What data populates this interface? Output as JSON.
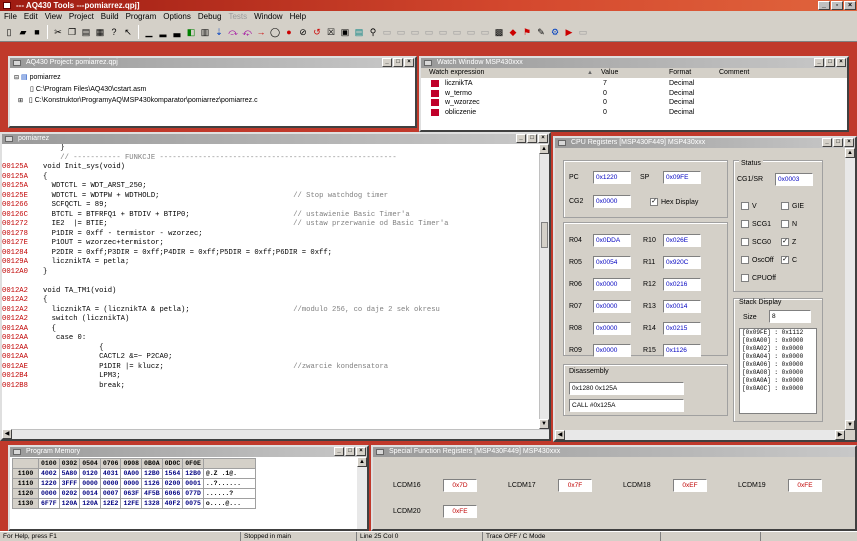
{
  "app": {
    "title": "--- AQ430 Tools ---pomiarrez.qpj]"
  },
  "menu": [
    "File",
    "Edit",
    "View",
    "Project",
    "Build",
    "Program",
    "Options",
    "Debug",
    "Tests",
    "Window",
    "Help"
  ],
  "menu_disabled": "Tests",
  "project": {
    "title": "AQ430 Project: pomiarrez.qpj",
    "root": "pomiarrez",
    "files": [
      "C:\\Program Files\\AQ430\\cstart.asm",
      "C:\\Konstruktor\\ProgramyAQ\\MSP430komparator\\pomiarrez\\pomiarrez.c"
    ]
  },
  "watch": {
    "title": "Watch Window MSP430xxx",
    "columns": [
      "Watch expression",
      "Value",
      "Format",
      "Comment"
    ],
    "rows": [
      {
        "expr": "licznikTA",
        "value": "7",
        "format": "Decimal"
      },
      {
        "expr": "w_termo",
        "value": "0",
        "format": "Decimal"
      },
      {
        "expr": "w_wzorzec",
        "value": "0",
        "format": "Decimal"
      },
      {
        "expr": "obliczenie",
        "value": "0",
        "format": "Decimal"
      }
    ]
  },
  "editor": {
    "title": "pomiarrez",
    "lines": [
      {
        "a": "",
        "c": "    }"
      },
      {
        "a": "",
        "c": "    // ----------- FUNKCJE -------------------------------------------------------",
        "cm": true
      },
      {
        "a": "00125A",
        "c": "void Init_sys(void)"
      },
      {
        "a": "00125A",
        "c": "{"
      },
      {
        "a": "00125A",
        "c": "  WDTCTL = WDT_ARST_250;"
      },
      {
        "a": "00125E",
        "c": "  WDTCTL = WDTPW + WDTHOLD;",
        "t": "// Stop watchdog timer"
      },
      {
        "a": "001266",
        "c": "  SCFQCTL = 89;"
      },
      {
        "a": "00126C",
        "c": "  BTCTL = BTFRFQ1 + BTDIV + BTIP0;",
        "t": "// ustawienie Basic Timer'a"
      },
      {
        "a": "001272",
        "c": "  IE2  |= BTIE;",
        "t": "// ustaw przerwanie od Basic Timer'a"
      },
      {
        "a": "001278",
        "c": "  P1DIR = 0xff - termistor - wzorzec;"
      },
      {
        "a": "00127E",
        "c": "  P1OUT = wzorzec+termistor;"
      },
      {
        "a": "001284",
        "c": "  P2DIR = 0xff;P3DIR = 0xff;P4DIR = 0xff;P5DIR = 0xff;P6DIR = 0xff;"
      },
      {
        "a": "00129A",
        "c": "  licznikTA = petla;"
      },
      {
        "a": "0012A0",
        "c": "}"
      },
      {
        "a": "",
        "c": ""
      },
      {
        "a": "0012A2",
        "c": "void TA_TM1(void)"
      },
      {
        "a": "0012A2",
        "c": "{"
      },
      {
        "a": "0012A2",
        "c": "  licznikTA = (licznikTA & petla);",
        "t": "//modulo 256, co daje 2 sek okresu"
      },
      {
        "a": "0012A2",
        "c": "  switch (licznikTA)"
      },
      {
        "a": "0012AA",
        "c": "  {"
      },
      {
        "a": "0012AA",
        "c": "   case 0:"
      },
      {
        "a": "0012AA",
        "c": "             {"
      },
      {
        "a": "0012AA",
        "c": "             CACTL2 &=~ P2CA0;"
      },
      {
        "a": "0012AE",
        "c": "             P1DIR |= klucz;",
        "t": "//zwarcie kondensatora"
      },
      {
        "a": "0012B4",
        "c": "             LPM3;"
      },
      {
        "a": "0012B8",
        "c": "             break;"
      }
    ]
  },
  "cpu": {
    "title": "CPU Registers [MSP430F449] MSP430xxx",
    "pc": {
      "label": "PC",
      "value": "0x1220"
    },
    "sp": {
      "label": "SP",
      "value": "0x09FE"
    },
    "cg2": {
      "label": "CG2",
      "value": "0x0000"
    },
    "hex_display": "Hex Display",
    "regs_left": [
      [
        "R04",
        "0x0DDA"
      ],
      [
        "R05",
        "0x0054"
      ],
      [
        "R06",
        "0x0000"
      ],
      [
        "R07",
        "0x0000"
      ],
      [
        "R08",
        "0x0000"
      ],
      [
        "R09",
        "0x0000"
      ]
    ],
    "regs_right": [
      [
        "R10",
        "0x026E"
      ],
      [
        "R11",
        "0x920C"
      ],
      [
        "R12",
        "0x0216"
      ],
      [
        "R13",
        "0x0014"
      ],
      [
        "R14",
        "0x0215"
      ],
      [
        "R15",
        "0x1126"
      ]
    ],
    "status": {
      "label": "Status",
      "cg1_label": "CG1/SR",
      "cg1_value": "0x0003",
      "flags": [
        [
          "V",
          false
        ],
        [
          "GIE",
          false
        ],
        [
          "SCG1",
          false
        ],
        [
          "N",
          false
        ],
        [
          "SCG0",
          false
        ],
        [
          "Z",
          true
        ],
        [
          "OscOff",
          false
        ],
        [
          "C",
          true
        ],
        [
          "CPUOff",
          false
        ]
      ]
    },
    "stack": {
      "label": "Stack Display",
      "size_label": "Size",
      "size": "8",
      "entries": [
        "[0x09FE] : 0x1112",
        "[0x0A00] : 0x0000",
        "[0x0A02] : 0x0000",
        "[0x0A04] : 0x0000",
        "[0x0A06] : 0x0000",
        "[0x0A08] : 0x0000",
        "[0x0A0A] : 0x0000",
        "[0x0A0C] : 0x0000"
      ]
    },
    "disasm": {
      "label": "Disassembly",
      "lines": [
        "0x1280 0x125A",
        "CALL #0x125A"
      ]
    }
  },
  "memory": {
    "title": "Program Memory",
    "header": [
      "",
      "0100",
      "0302",
      "0504",
      "0706",
      "0908",
      "0B0A",
      "0D0C",
      "0F0E",
      ""
    ],
    "rows": [
      [
        "1100",
        "4002",
        "5A80",
        "0120",
        "4031",
        "0A00",
        "12B0",
        "1564",
        "12B0",
        "@.Z .1@."
      ],
      [
        "1110",
        "1220",
        "3FFF",
        "0000",
        "0000",
        "0000",
        "1126",
        "0200",
        "0001",
        "..?......"
      ],
      [
        "1120",
        "0000",
        "0202",
        "0014",
        "0007",
        "063F",
        "4F5B",
        "6066",
        "077D",
        "......?"
      ],
      [
        "1130",
        "6F7F",
        "120A",
        "120A",
        "12E2",
        "12FE",
        "1328",
        "40F2",
        "0075",
        "o....@..."
      ]
    ]
  },
  "sfr": {
    "title": "Special Function Registers [MSP430F449] MSP430xxx",
    "row1": [
      [
        "LCDM16",
        "0x7D"
      ],
      [
        "LCDM17",
        "0x7F"
      ],
      [
        "LCDM18",
        "0xEF"
      ],
      [
        "LCDM19",
        "0xFE"
      ]
    ],
    "row2": [
      [
        "LCDM20",
        "0xFE"
      ]
    ]
  },
  "status": {
    "help": "For Help, press F1",
    "state": "Stopped in main",
    "pos": "Line   25 Col  0",
    "mode": "Trace OFF / C Mode"
  },
  "colors": {
    "desktop": "#c0392b",
    "address": "#c00000",
    "register_value": "#0000c0"
  }
}
